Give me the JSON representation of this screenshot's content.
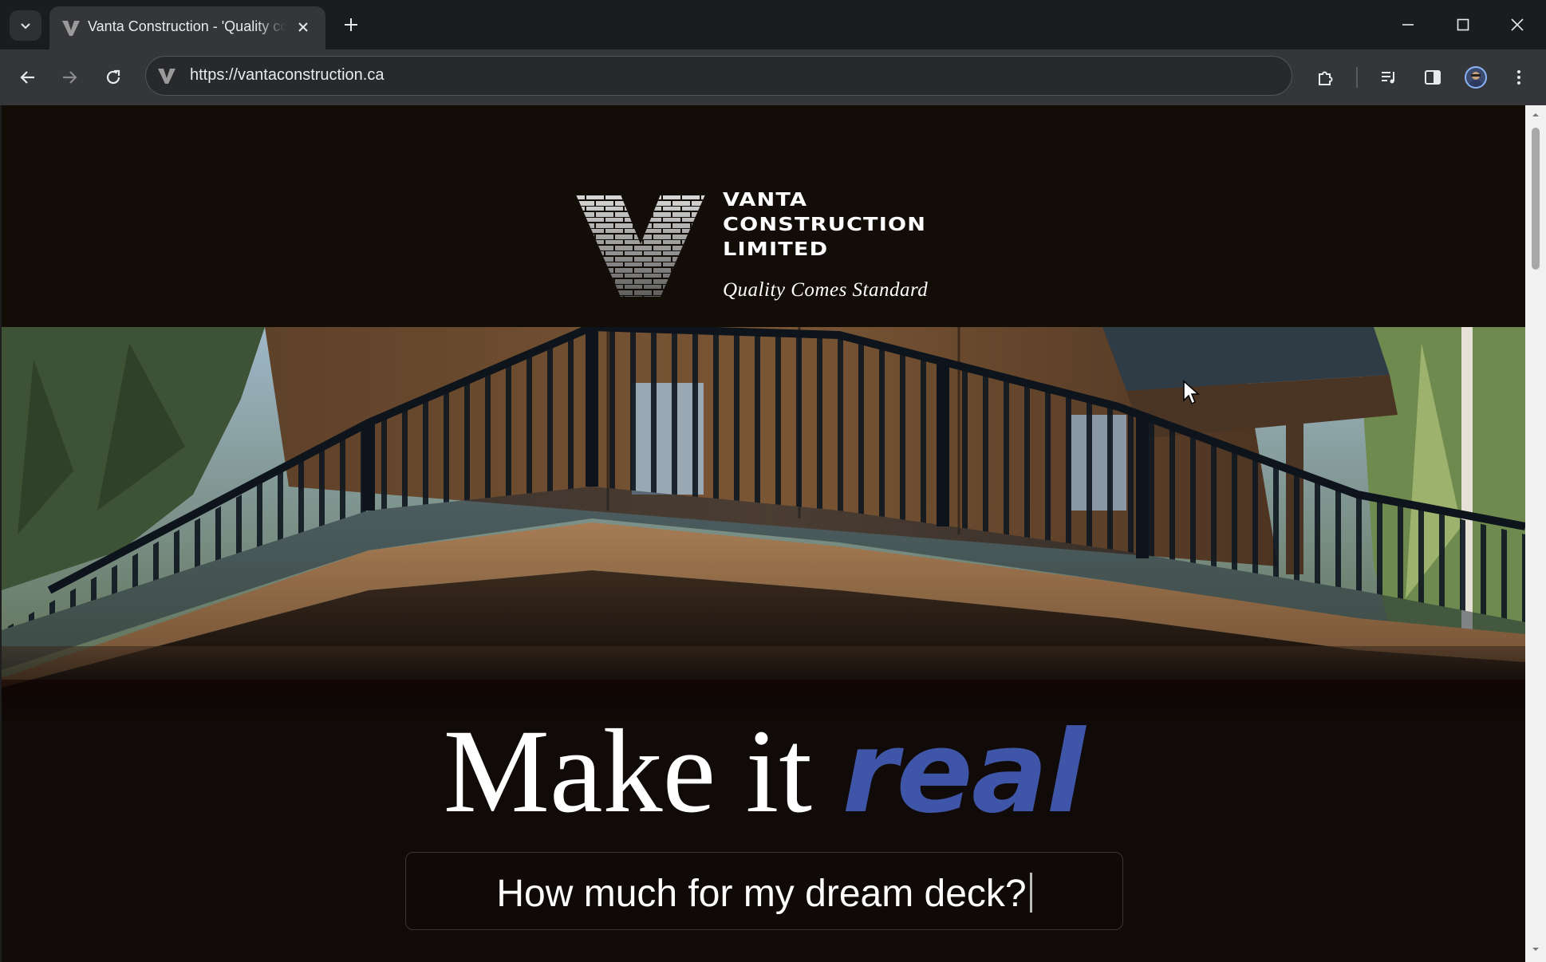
{
  "browser": {
    "tab": {
      "title": "Vanta Construction - 'Quality comes standard'"
    },
    "url": "https://vantaconstruction.ca",
    "icons": {
      "tab_search": "chevron-down-icon",
      "tab_close": "close-icon",
      "new_tab": "plus-icon",
      "back": "arrow-left-icon",
      "forward": "arrow-right-icon",
      "reload": "reload-icon",
      "extensions": "puzzle-icon",
      "media": "media-control-icon",
      "side_panel": "side-panel-icon",
      "profile": "avatar",
      "menu": "kebab-menu-icon",
      "minimize": "minimize-icon",
      "maximize": "maximize-icon",
      "close": "close-window-icon"
    }
  },
  "site": {
    "brand_lines": [
      "VANTA",
      "CONSTRUCTION",
      "LIMITED"
    ],
    "tagline": "Quality Comes Standard",
    "headline": {
      "main": "Make it ",
      "accent": "real"
    },
    "quote_prompt": "How much for my dream deck?",
    "colors": {
      "background": "#100b08",
      "accent": "#3f55a8",
      "text": "#ffffff"
    }
  }
}
